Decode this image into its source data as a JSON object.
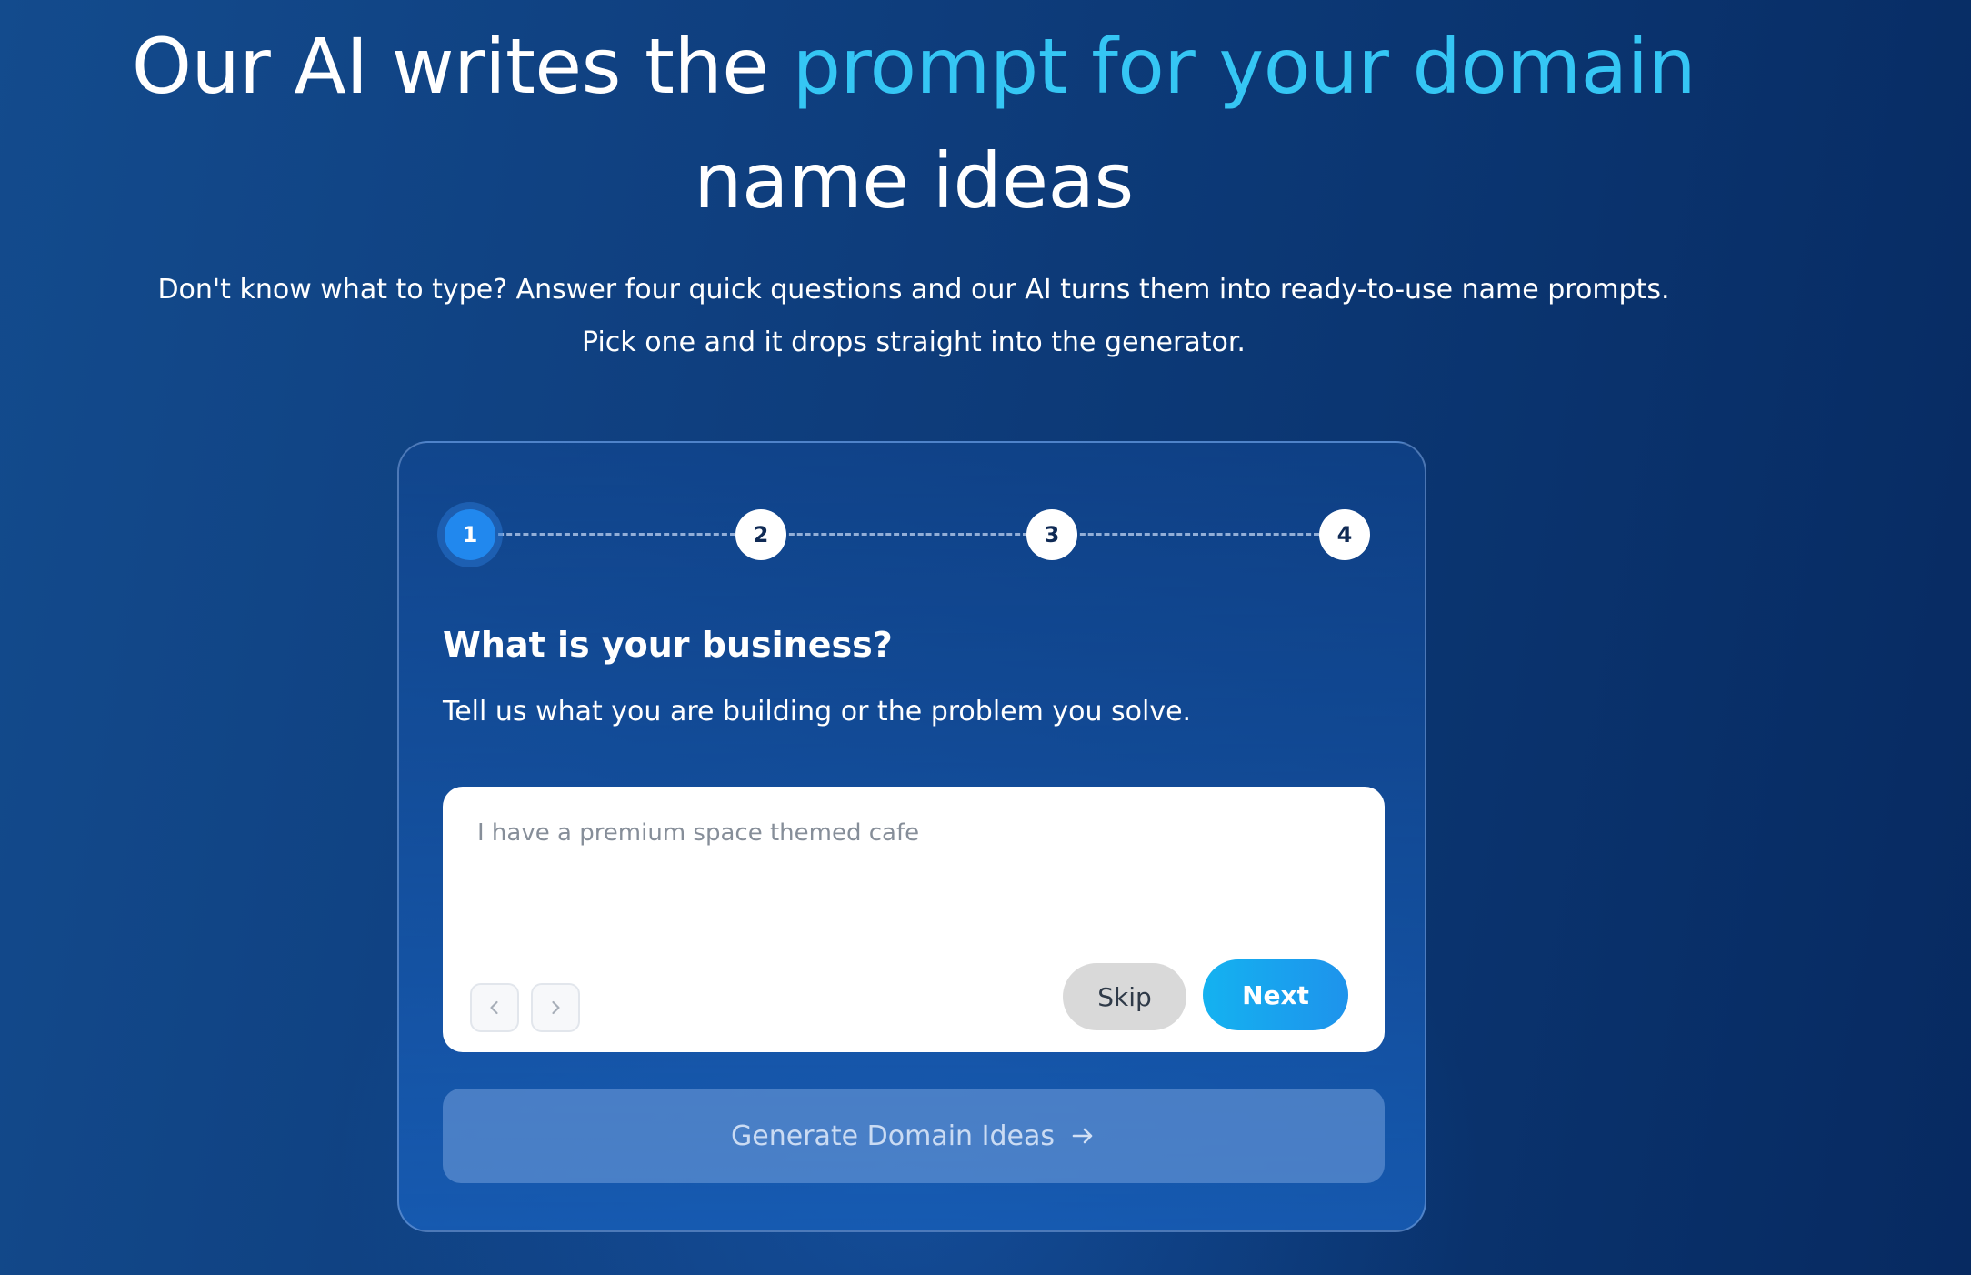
{
  "hero": {
    "headline_part1": "Our AI writes the ",
    "headline_accent": "prompt for your domain",
    "headline_line2": "name ideas",
    "subtitle_line1": "Don't know what to type? Answer four quick questions and our AI turns them into ready-to-use name prompts.",
    "subtitle_line2": "Pick one and it drops straight into the generator.",
    "accent_color": "#35c6f4"
  },
  "wizard": {
    "steps": [
      "1",
      "2",
      "3",
      "4"
    ],
    "active_step": 1,
    "question_title": "What is your business?",
    "question_description": "Tell us what you are building or the problem you solve.",
    "input": {
      "value": "",
      "placeholder": "I have a premium space themed cafe"
    },
    "prev_icon": "chevron-left-icon",
    "next_icon": "chevron-right-icon",
    "skip_label": "Skip",
    "next_label": "Next",
    "generate_label": "Generate Domain Ideas",
    "generate_icon": "arrow-right-icon",
    "next_button_color": "#14b2f0"
  }
}
